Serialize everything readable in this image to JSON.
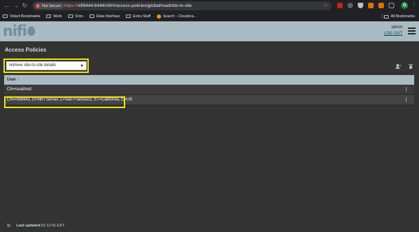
{
  "browser": {
    "not_secure_label": "Not Secure",
    "url_scheme": "https://",
    "url_rest": "nifi8444:8444/nifi/#/access-policies/global/read/site-to-site",
    "profile_initial": "G",
    "bookmarks": [
      {
        "label": "Volant Bookmarks",
        "icon": "folder-icon"
      },
      {
        "label": "Work",
        "icon": "folder-icon"
      },
      {
        "label": "Octo",
        "icon": "folder-icon"
      },
      {
        "label": "Data Interfuse",
        "icon": "folder-icon"
      },
      {
        "label": "Extra Stuff",
        "icon": "folder-icon"
      },
      {
        "label": "Search - Cloudera...",
        "icon": "cloudera-icon"
      }
    ],
    "all_bookmarks_label": "All Bookmarks"
  },
  "header": {
    "logo_text": "nifi",
    "username": "admin",
    "logout_label": "LOG OUT"
  },
  "page": {
    "title": "Access Policies",
    "policy_select_value": "retrieve site-to-site details"
  },
  "table": {
    "column_user": "User",
    "sort_indicator": "↑",
    "rows": [
      {
        "user": "CN=localhost"
      },
      {
        "user": "CN=nifi8443, O=NiFi Server, L=San Francisco, ST=California, C=US"
      }
    ]
  },
  "footer": {
    "last_updated_label": "Last updated:",
    "last_updated_value": "21:12:41 EDT"
  },
  "colors": {
    "header_bg": "#aabbc3",
    "main_bg": "#333333",
    "highlight": "#f2e600"
  }
}
